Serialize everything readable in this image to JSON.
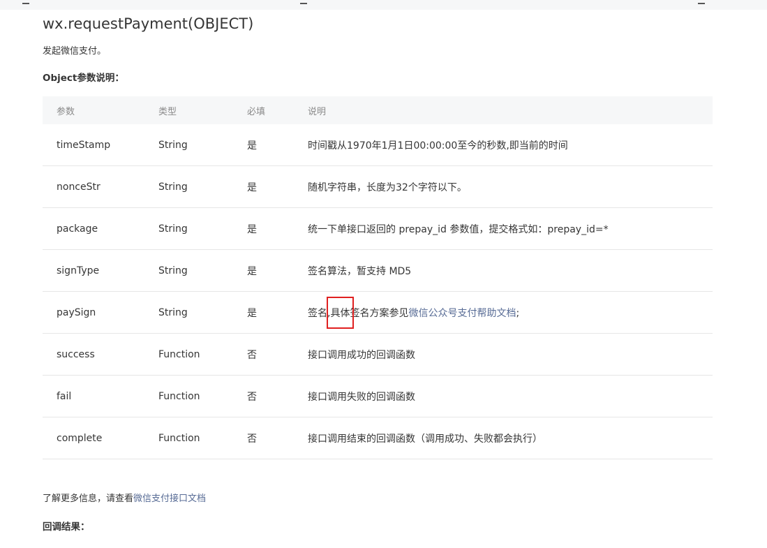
{
  "page": {
    "title": "wx.requestPayment(OBJECT)",
    "description": "发起微信支付。",
    "params_heading": "Object参数说明：",
    "more_text": "了解更多信息，请查看",
    "more_link": "微信支付接口文档",
    "callback_heading": "回调结果："
  },
  "table": {
    "headers": [
      "参数",
      "类型",
      "必填",
      "说明"
    ],
    "rows": [
      {
        "name": "timeStamp",
        "type": "String",
        "required": "是",
        "desc": "时间戳从1970年1月1日00:00:00至今的秒数,即当前的时间"
      },
      {
        "name": "nonceStr",
        "type": "String",
        "required": "是",
        "desc": "随机字符串，长度为32个字符以下。"
      },
      {
        "name": "package",
        "type": "String",
        "required": "是",
        "desc": "统一下单接口返回的 prepay_id 参数值，提交格式如：prepay_id=*"
      },
      {
        "name": "signType",
        "type": "String",
        "required": "是",
        "desc": "签名算法，暂支持 MD5"
      },
      {
        "name": "paySign",
        "type": "String",
        "required": "是",
        "desc_pre": "签名,",
        "desc_highlight": "具体",
        "desc_mid": "签名方案参见",
        "desc_link": "微信公众号支付帮助文档",
        "desc_post": ";"
      },
      {
        "name": "success",
        "type": "Function",
        "required": "否",
        "desc": "接口调用成功的回调函数"
      },
      {
        "name": "fail",
        "type": "Function",
        "required": "否",
        "desc": "接口调用失败的回调函数"
      },
      {
        "name": "complete",
        "type": "Function",
        "required": "否",
        "desc": "接口调用结束的回调函数（调用成功、失败都会执行）"
      }
    ]
  },
  "colors": {
    "link": "#576b95",
    "highlight_box": "#e02020",
    "header_bg": "#f6f7f8"
  }
}
